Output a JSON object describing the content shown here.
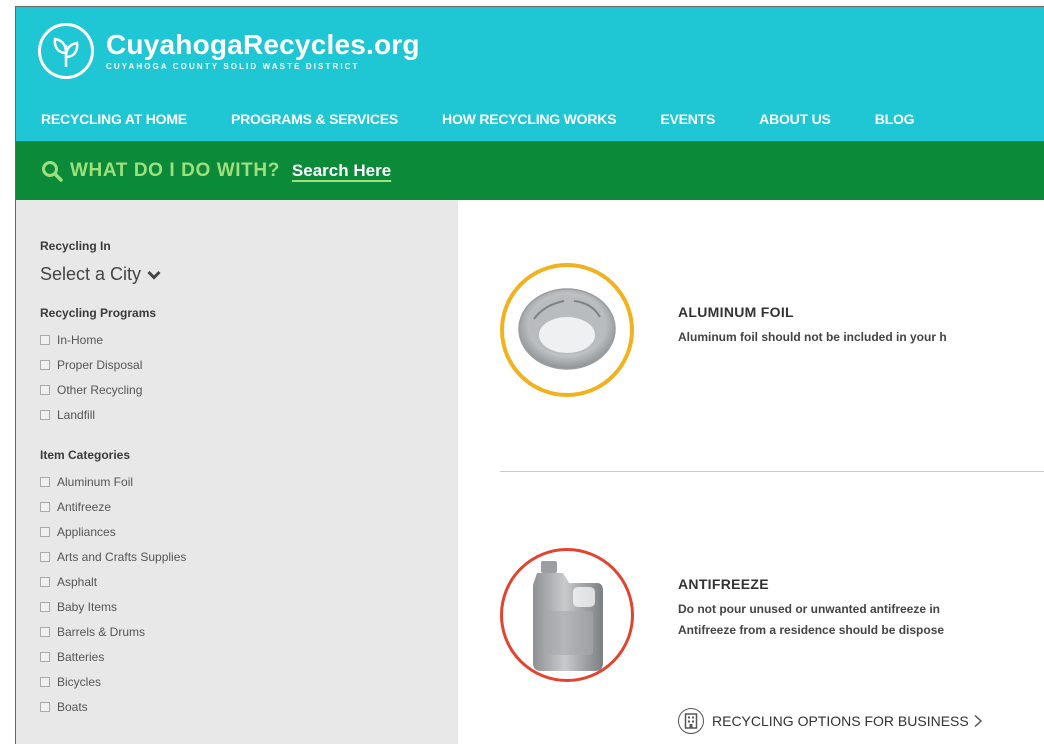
{
  "header": {
    "logo_title": "CuyahogaRecycles.org",
    "logo_subtitle": "CUYAHOGA COUNTY SOLID WASTE DISTRICT",
    "nav": [
      {
        "label": "RECYCLING AT HOME"
      },
      {
        "label": "PROGRAMS & SERVICES"
      },
      {
        "label": "HOW RECYCLING WORKS"
      },
      {
        "label": "EVENTS"
      },
      {
        "label": "ABOUT US"
      },
      {
        "label": "BLOG"
      }
    ],
    "brand_color": "#1fc6d3"
  },
  "searchbar": {
    "question": "WHAT DO I DO WITH?",
    "link": "Search Here",
    "color": "#0b8a3a"
  },
  "sidebar": {
    "recycling_in_label": "Recycling In",
    "city_select": "Select a City",
    "programs_label": "Recycling Programs",
    "programs": [
      "In-Home",
      "Proper Disposal",
      "Other Recycling",
      "Landfill"
    ],
    "categories_label": "Item Categories",
    "categories": [
      "Aluminum Foil",
      "Antifreeze",
      "Appliances",
      "Arts and Crafts Supplies",
      "Asphalt",
      "Baby Items",
      "Barrels & Drums",
      "Batteries",
      "Bicycles",
      "Boats"
    ]
  },
  "main": {
    "items": [
      {
        "title": "ALUMINUM FOIL",
        "desc1": "Aluminum foil should not be included in your h",
        "ring_color": "#f2b11e",
        "icon": "aluminum-pan"
      },
      {
        "title": "ANTIFREEZE",
        "desc1": "Do not pour unused or unwanted antifreeze in",
        "desc2": "Antifreeze from a residence should be dispose",
        "ring_color": "#e1452f",
        "icon": "antifreeze-jug"
      }
    ],
    "business_link": "RECYCLING OPTIONS FOR BUSINESS"
  }
}
